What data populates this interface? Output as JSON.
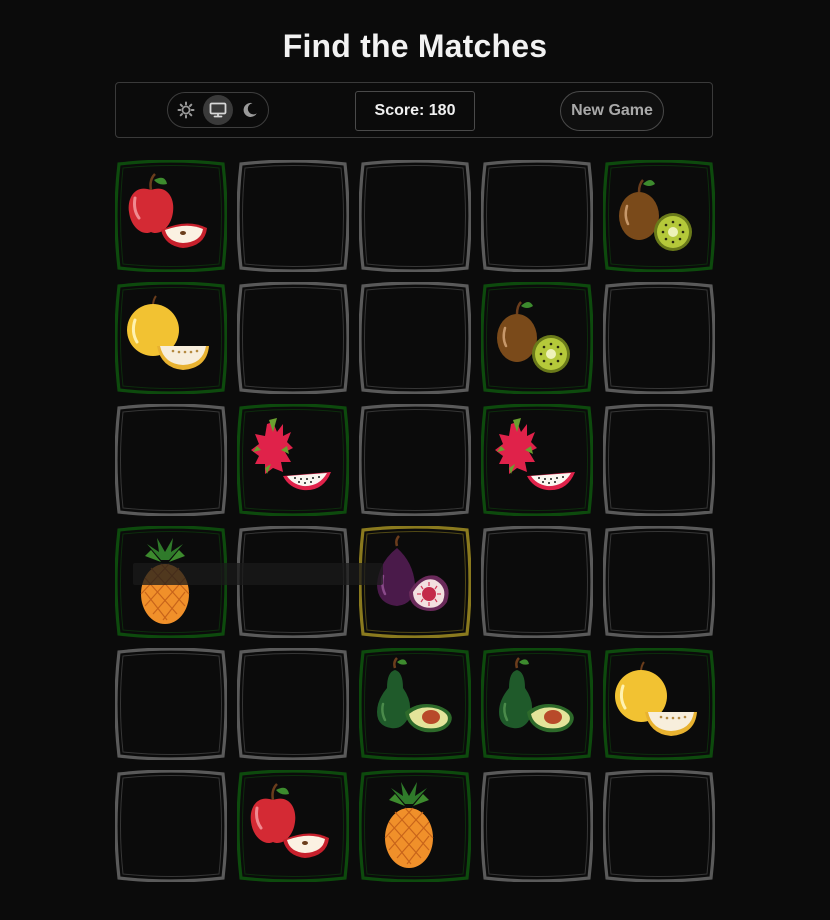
{
  "title": "Find the Matches",
  "theme_switch": {
    "options": [
      {
        "name": "light",
        "icon": "sun-icon",
        "active": false
      },
      {
        "name": "system",
        "icon": "monitor-icon",
        "active": true
      },
      {
        "name": "dark",
        "icon": "moon-icon",
        "active": false
      }
    ]
  },
  "score_label": "Score: 180",
  "new_game_label": "New Game",
  "colors": {
    "background": "#0b0b0b",
    "matched_frame": "#0d4a0d",
    "selected_frame": "#8a7a1e",
    "hidden_frame": "#5a5a5a"
  },
  "board": {
    "rows": 6,
    "cols": 5,
    "cards": [
      {
        "state": "matched",
        "fruit": "apple"
      },
      {
        "state": "hidden",
        "fruit": ""
      },
      {
        "state": "hidden",
        "fruit": ""
      },
      {
        "state": "hidden",
        "fruit": ""
      },
      {
        "state": "matched",
        "fruit": "kiwi"
      },
      {
        "state": "matched",
        "fruit": "melon"
      },
      {
        "state": "hidden",
        "fruit": ""
      },
      {
        "state": "hidden",
        "fruit": ""
      },
      {
        "state": "matched",
        "fruit": "kiwi"
      },
      {
        "state": "hidden",
        "fruit": ""
      },
      {
        "state": "hidden",
        "fruit": ""
      },
      {
        "state": "matched",
        "fruit": "dragonfruit"
      },
      {
        "state": "hidden",
        "fruit": ""
      },
      {
        "state": "matched",
        "fruit": "dragonfruit"
      },
      {
        "state": "hidden",
        "fruit": ""
      },
      {
        "state": "matched",
        "fruit": "pineapple"
      },
      {
        "state": "hidden",
        "fruit": ""
      },
      {
        "state": "selected",
        "fruit": "fig"
      },
      {
        "state": "hidden",
        "fruit": ""
      },
      {
        "state": "hidden",
        "fruit": ""
      },
      {
        "state": "hidden",
        "fruit": ""
      },
      {
        "state": "hidden",
        "fruit": ""
      },
      {
        "state": "matched",
        "fruit": "avocado"
      },
      {
        "state": "matched",
        "fruit": "avocado"
      },
      {
        "state": "matched",
        "fruit": "melon"
      },
      {
        "state": "hidden",
        "fruit": ""
      },
      {
        "state": "matched",
        "fruit": "apple"
      },
      {
        "state": "matched",
        "fruit": "pineapple"
      },
      {
        "state": "hidden",
        "fruit": ""
      },
      {
        "state": "hidden",
        "fruit": ""
      }
    ]
  }
}
